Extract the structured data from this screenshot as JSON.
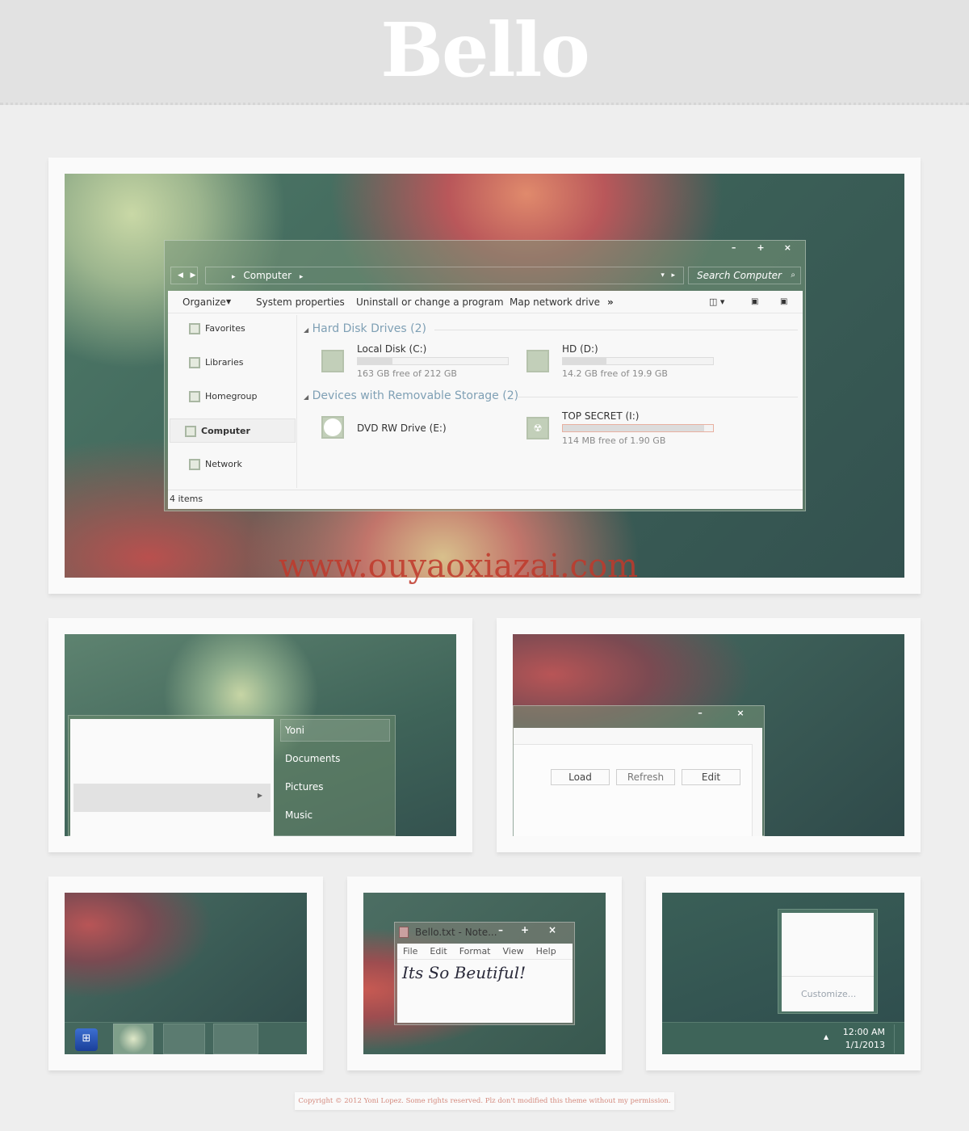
{
  "header": {
    "title": "Bello"
  },
  "explorer": {
    "window_controls": {
      "minimize": "–",
      "maximize": "+",
      "close": "×"
    },
    "breadcrumb": "Computer",
    "search_placeholder": "Search Computer",
    "toolbar": {
      "organize": "Organize",
      "system_properties": "System properties",
      "uninstall": "Uninstall or change a program",
      "map_drive": "Map network drive",
      "more": "»"
    },
    "nav": [
      {
        "label": "Favorites"
      },
      {
        "label": "Libraries"
      },
      {
        "label": "Homegroup"
      },
      {
        "label": "Computer"
      },
      {
        "label": "Network"
      }
    ],
    "groups": [
      {
        "title": "Hard Disk Drives (2)",
        "drives": [
          {
            "name": "Local Disk (C:)",
            "info": "163 GB free of 212 GB",
            "used_fraction": 0.23
          },
          {
            "name": "HD (D:)",
            "info": "14.2 GB free of 19.9 GB",
            "used_fraction": 0.29
          }
        ]
      },
      {
        "title": "Devices with Removable Storage (2)",
        "drives": [
          {
            "name": "DVD RW Drive (E:)"
          },
          {
            "name": "TOP SECRET (I:)",
            "info": "114 MB free of 1.90 GB",
            "used_fraction": 0.94
          }
        ]
      }
    ],
    "status": "4 items"
  },
  "watermark": "www.ouyaoxiazai.com",
  "start_menu": {
    "items": [
      "Yoni",
      "Documents",
      "Pictures",
      "Music"
    ]
  },
  "dialog": {
    "buttons": [
      "Load",
      "Refresh",
      "Edit"
    ],
    "controls": {
      "minimize": "–",
      "close": "×"
    }
  },
  "notepad": {
    "title": "Bello.txt - Note...",
    "menu": [
      "File",
      "Edit",
      "Format",
      "View",
      "Help"
    ],
    "content": "Its So Beutiful!"
  },
  "tray": {
    "customize": "Customize...",
    "time": "12:00 AM",
    "date": "1/1/2013",
    "arrow": "▲"
  },
  "footer": {
    "copyright": "Copyright © 2012 Yoni Lopez. Some rights reserved. Plz don't modified this theme without my permission."
  },
  "colors": {
    "accent_group": "#7fa0b5",
    "watermark": "#c0392b",
    "copyright": "#d48a7e"
  }
}
